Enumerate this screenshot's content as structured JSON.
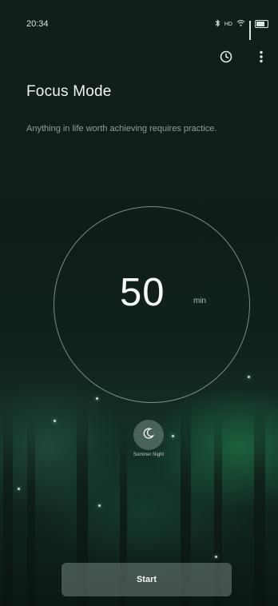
{
  "status_bar": {
    "time": "20:34",
    "icons": [
      "bluetooth-icon",
      "hd-icon",
      "wifi-icon",
      "signal-icon",
      "battery-icon"
    ]
  },
  "top_actions": {
    "icons": [
      "history-clock-icon",
      "more-vert-icon"
    ]
  },
  "header": {
    "title": "Focus Mode",
    "subtitle": "Anything in life worth achieving requires practice."
  },
  "timer": {
    "value": "50",
    "unit": "min"
  },
  "sound": {
    "icon": "moon-icon",
    "label": "Summer Night"
  },
  "start_button": {
    "label": "Start"
  },
  "colors": {
    "background": "#0e1714",
    "accent_green": "#2caa60",
    "text": "#e9f0ec"
  }
}
